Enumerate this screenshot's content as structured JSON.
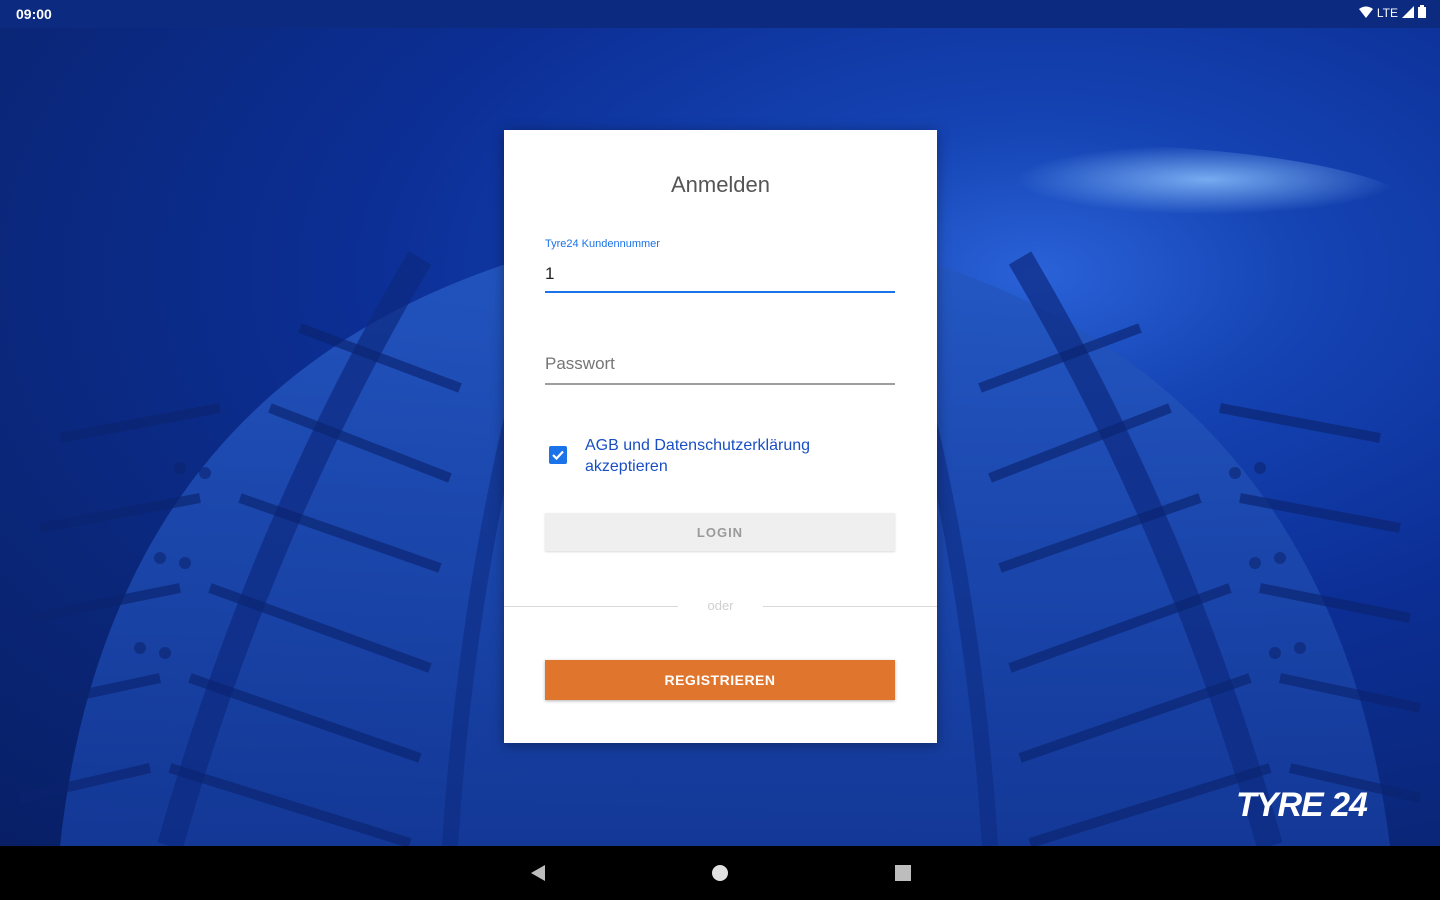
{
  "status_bar": {
    "time": "09:00",
    "network": "LTE"
  },
  "login_card": {
    "title": "Anmelden",
    "customer_number": {
      "label": "Tyre24 Kundennummer",
      "value": "1"
    },
    "password": {
      "placeholder": "Passwort",
      "value": ""
    },
    "terms_checkbox": {
      "checked": true,
      "label": "AGB und Datenschutzerklärung akzeptieren"
    },
    "login_button": "LOGIN",
    "divider_text": "oder",
    "register_button": "REGISTRIEREN"
  },
  "brand": {
    "logo_text": "TYRE 24"
  },
  "nav_bar": {
    "icons": [
      "back-icon",
      "home-icon",
      "recents-icon"
    ]
  },
  "colors": {
    "accent": "#1a73e8",
    "register": "#e0752e",
    "background": "#0c2f96"
  }
}
